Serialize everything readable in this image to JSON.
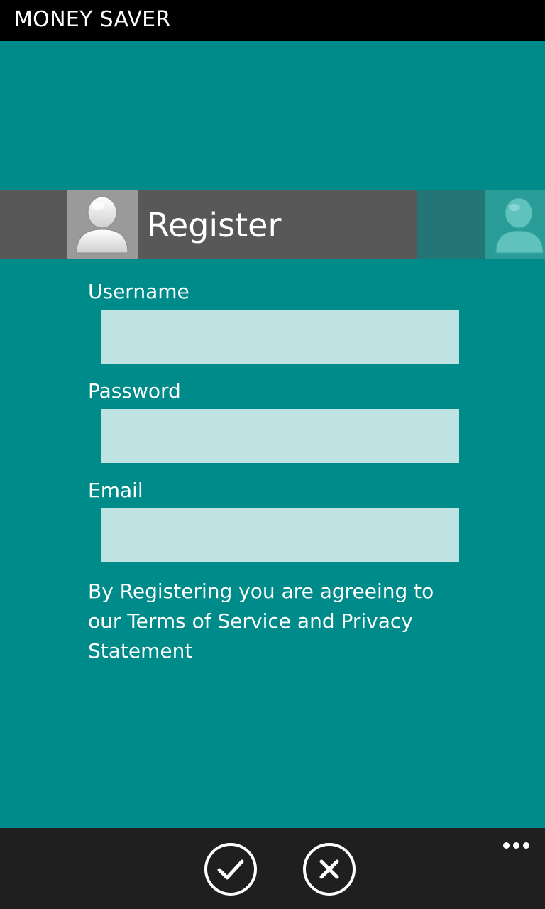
{
  "app": {
    "title": "MONEY SAVER"
  },
  "header": {
    "title": "Register",
    "avatar_icon": "user-icon"
  },
  "form": {
    "username": {
      "label": "Username",
      "value": "",
      "placeholder": ""
    },
    "password": {
      "label": "Password",
      "value": "",
      "placeholder": ""
    },
    "email": {
      "label": "Email",
      "value": "",
      "placeholder": ""
    }
  },
  "terms_text": "By Registering you are agreeing to our Terms of Service and Privacy Statement",
  "appbar": {
    "buttons": [
      {
        "icon": "checkmark-icon"
      },
      {
        "icon": "close-icon"
      }
    ],
    "more_icon": "ellipsis-icon"
  },
  "colors": {
    "background": "#008B8B",
    "titlebar": "#000000",
    "header_band": "#585858",
    "input_fill": "#BFE2E2",
    "appbar": "#1F1F1F"
  }
}
